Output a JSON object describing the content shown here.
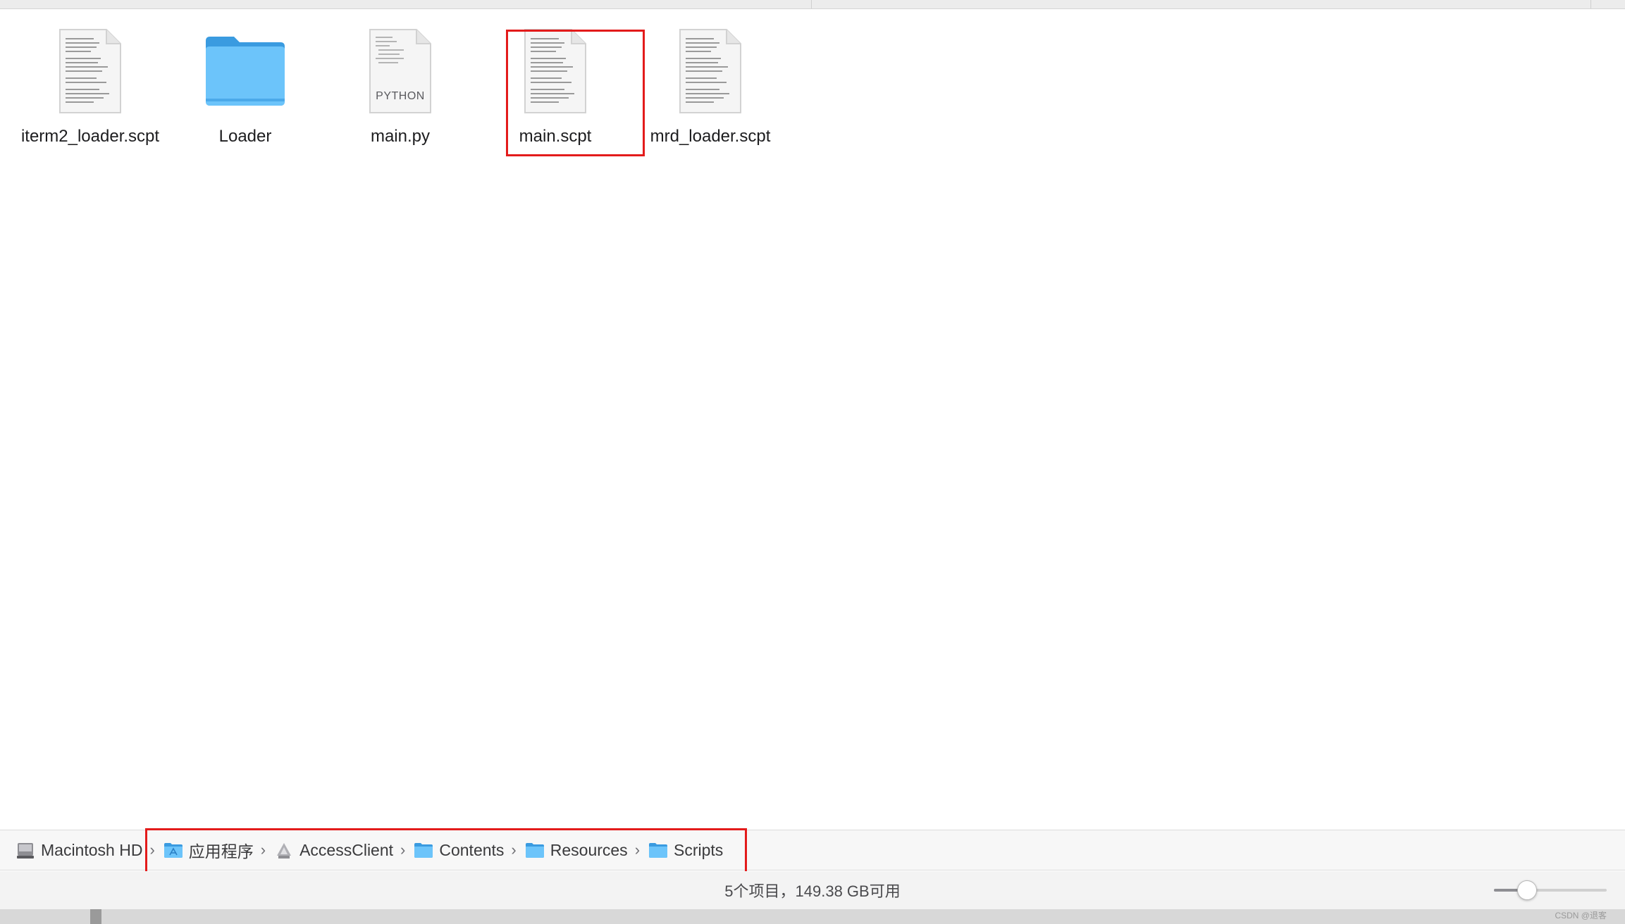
{
  "window": {
    "files": [
      {
        "name": "iterm2_loader.scpt",
        "kind": "script-document",
        "selected": false
      },
      {
        "name": "Loader",
        "kind": "folder",
        "selected": false
      },
      {
        "name": "main.py",
        "kind": "python-document",
        "badge": "PYTHON",
        "selected": false
      },
      {
        "name": "main.scpt",
        "kind": "script-document",
        "selected": true
      },
      {
        "name": "mrd_loader.scpt",
        "kind": "script-document",
        "selected": false
      }
    ]
  },
  "path_bar": {
    "crumbs": [
      {
        "label": "Macintosh HD",
        "icon": "hard-drive-icon"
      },
      {
        "label": "应用程序",
        "icon": "applications-folder-icon"
      },
      {
        "label": "AccessClient",
        "icon": "app-icon"
      },
      {
        "label": "Contents",
        "icon": "folder-icon"
      },
      {
        "label": "Resources",
        "icon": "folder-icon"
      },
      {
        "label": "Scripts",
        "icon": "folder-icon"
      }
    ],
    "separator": "›"
  },
  "status_bar": {
    "text": "5个项目，149.38 GB可用"
  },
  "zoom": {
    "level": 0.25
  },
  "watermark": "CSDN @退客",
  "colors": {
    "folder_blue": "#5cb8f5",
    "highlight_red": "#e31b1b"
  }
}
